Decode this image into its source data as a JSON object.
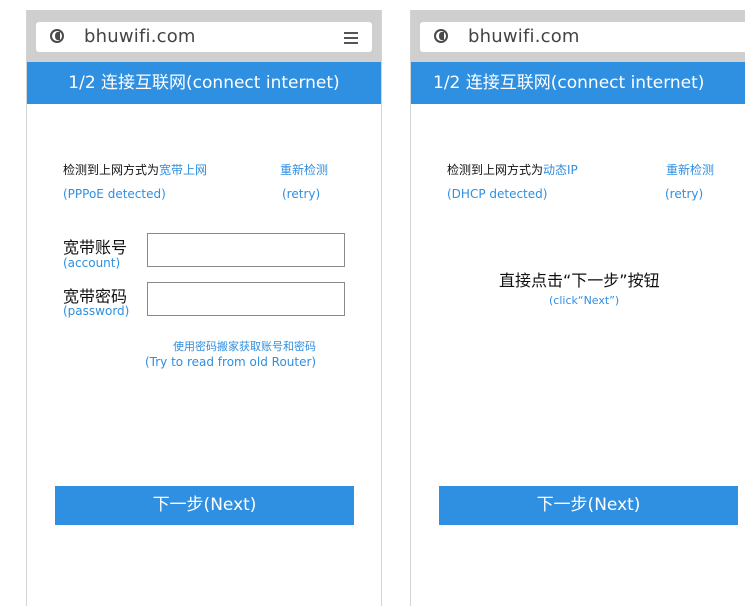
{
  "left": {
    "url": "bhuwifi.com",
    "title": "1/2 连接互联网(connect internet)",
    "detected_prefix": "检测到上网方式为",
    "detected_value": "宽带上网",
    "retry_label": "重新检测",
    "detected_en": "(PPPoE detected)",
    "retry_en": "(retry)",
    "account_label": "宽带账号",
    "account_en": "(account)",
    "account_value": "",
    "password_label": "宽带密码",
    "password_en": "(password)",
    "password_value": "",
    "read_router_cn": "使用密码搬家获取账号和密码",
    "read_router_en": "(Try to read from old Router)",
    "next_label": "下一步(Next)"
  },
  "right": {
    "url": "bhuwifi.com",
    "title": "1/2 连接互联网(connect internet)",
    "detected_prefix": "检测到上网方式为",
    "detected_value": "动态IP",
    "retry_label": "重新检测",
    "detected_en": "(DHCP detected)",
    "retry_en": "(retry)",
    "instruction_cn": "直接点击“下一步”按钮",
    "instruction_en": "(click“Next”)",
    "next_label": "下一步(Next)"
  },
  "colors": {
    "accent": "#2f8fe0",
    "browser_bar": "#cfcfcf"
  },
  "icons": {
    "url_bar_left": "globe-icon",
    "url_bar_right": "menu-icon"
  }
}
